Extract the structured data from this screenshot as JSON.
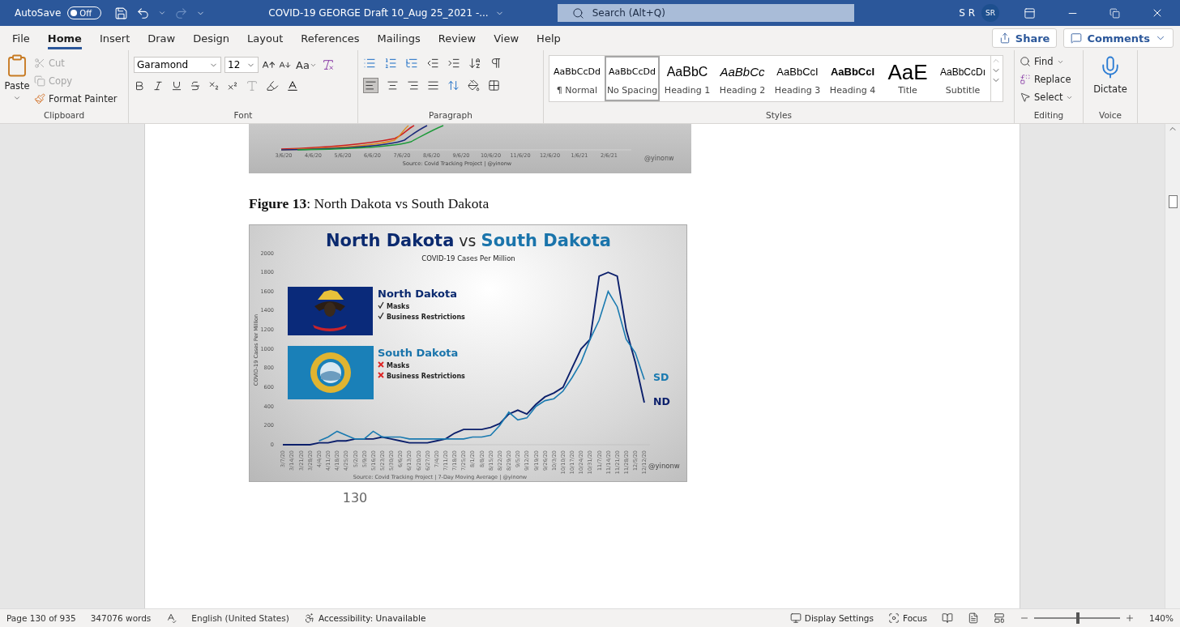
{
  "title_bar": {
    "autosave": {
      "label": "AutoSave",
      "on": false,
      "state_label": "Off"
    },
    "document_title": "COVID-19 GEORGE Draft 10_Aug 25_2021  -...",
    "search": {
      "placeholder": "Search (Alt+Q)"
    },
    "user_name": "S R",
    "avatar": "SR"
  },
  "menu_tabs": [
    {
      "label": "File",
      "selected": false
    },
    {
      "label": "Home",
      "selected": true
    },
    {
      "label": "Insert",
      "selected": false
    },
    {
      "label": "Draw",
      "selected": false
    },
    {
      "label": "Design",
      "selected": false
    },
    {
      "label": "Layout",
      "selected": false
    },
    {
      "label": "References",
      "selected": false
    },
    {
      "label": "Mailings",
      "selected": false
    },
    {
      "label": "Review",
      "selected": false
    },
    {
      "label": "View",
      "selected": false
    },
    {
      "label": "Help",
      "selected": false
    }
  ],
  "share_button": "Share",
  "comments_button": "Comments",
  "ribbon": {
    "clipboard": {
      "label": "Clipboard",
      "paste": "Paste",
      "cut": {
        "label": "Cut",
        "disabled": true
      },
      "copy": {
        "label": "Copy",
        "disabled": true
      },
      "format_painter": {
        "label": "Format Painter",
        "disabled": false
      }
    },
    "font": {
      "label": "Font",
      "font_name": "Garamond",
      "font_size": "12",
      "change_case": "Aa"
    },
    "paragraph": {
      "label": "Paragraph"
    },
    "styles": {
      "label": "Styles",
      "items": [
        {
          "preview": "AaBbCcDd",
          "name": "¶ Normal",
          "selected": false
        },
        {
          "preview": "AaBbCcDd",
          "name": "No Spacing",
          "selected": true
        },
        {
          "preview": "AaBbC",
          "name": "Heading 1",
          "selected": false
        },
        {
          "preview": "AaBbCc",
          "name": "Heading 2",
          "selected": false
        },
        {
          "preview": "AaBbCcI",
          "name": "Heading 3",
          "selected": false
        },
        {
          "preview": "AaBbCcI",
          "name": "Heading 4",
          "selected": false
        },
        {
          "preview": "AaE",
          "name": "Title",
          "selected": false
        },
        {
          "preview": "AaBbCcDı",
          "name": "Subtitle",
          "selected": false
        }
      ]
    },
    "editing": {
      "label": "Editing",
      "find": "Find",
      "replace": "Replace",
      "select": "Select"
    },
    "voice": {
      "label": "Voice",
      "dictate": "Dictate"
    }
  },
  "document": {
    "top_figure": {
      "x_labels": [
        "3/6/20",
        "4/6/20",
        "5/6/20",
        "6/6/20",
        "7/6/20",
        "8/6/20",
        "9/6/20",
        "10/6/20",
        "11/6/20",
        "12/6/20",
        "1/6/21",
        "2/6/21"
      ],
      "source": "Source: Covid Tracking Project | @yinonw",
      "handle": "@yinonw"
    },
    "caption": "**Figure 13**: North Dakota vs South Dakota",
    "chart": {
      "title_left": "North Dakota",
      "title_mid": "vs",
      "title_right": "South Dakota",
      "legend": [
        {
          "state": "North Dakota",
          "color": "#0b2a6f",
          "items": [
            {
              "label": "Masks",
              "checked": true
            },
            {
              "label": "Business Restrictions",
              "checked": true
            }
          ]
        },
        {
          "state": "South Dakota",
          "color": "#1a74ab",
          "items": [
            {
              "label": "Masks",
              "checked": false
            },
            {
              "label": "Business Restrictions",
              "checked": false
            }
          ]
        }
      ],
      "handle": "@yinonw",
      "source": "Source: Covid Tracking Project | 7-Day Moving Average | @yinonw",
      "chart_data": {
        "type": "line",
        "title": "COVID-19 Cases Per Million",
        "ylabel": "COVID-19 Cases Per Million",
        "categories": [
          "3/7/20",
          "3/14/20",
          "3/21/20",
          "3/28/20",
          "4/4/20",
          "4/11/20",
          "4/18/20",
          "4/25/20",
          "5/2/20",
          "5/9/20",
          "5/16/20",
          "5/23/20",
          "5/30/20",
          "6/6/20",
          "6/13/20",
          "6/20/20",
          "6/27/20",
          "7/4/20",
          "7/11/20",
          "7/18/20",
          "7/25/20",
          "8/1/20",
          "8/8/20",
          "8/15/20",
          "8/22/20",
          "8/29/20",
          "9/5/20",
          "9/12/20",
          "9/19/20",
          "9/26/20",
          "10/3/20",
          "10/10/20",
          "10/17/20",
          "10/24/20",
          "10/31/20",
          "11/7/20",
          "11/14/20",
          "11/21/20",
          "11/28/20",
          "12/5/20",
          "12/12/20"
        ],
        "series": [
          {
            "name": "SD",
            "color": "#1a7ab0",
            "values": [
              null,
              null,
              null,
              null,
              40,
              80,
              140,
              100,
              60,
              60,
              140,
              80,
              80,
              80,
              60,
              60,
              60,
              60,
              60,
              60,
              60,
              80,
              80,
              100,
              200,
              340,
              260,
              280,
              400,
              460,
              480,
              560,
              700,
              860,
              1100,
              1300,
              1600,
              1440,
              1100,
              960,
              680
            ]
          },
          {
            "name": "ND",
            "color": "#0b1f6b",
            "values": [
              0,
              0,
              0,
              0,
              20,
              20,
              40,
              40,
              60,
              60,
              60,
              80,
              60,
              40,
              20,
              20,
              20,
              40,
              60,
              120,
              160,
              160,
              160,
              180,
              220,
              320,
              360,
              320,
              420,
              500,
              540,
              600,
              800,
              1000,
              1100,
              1760,
              1800,
              1760,
              1200,
              860,
              440
            ]
          }
        ],
        "ylim": [
          0,
          2000
        ],
        "yticks": [
          0,
          200,
          400,
          600,
          800,
          1000,
          1200,
          1400,
          1600,
          1800,
          2000
        ]
      }
    },
    "page_number": "130"
  },
  "status_bar": {
    "page": "Page 130 of 935",
    "words": "347076 words",
    "language": "English (United States)",
    "accessibility": "Accessibility: Unavailable",
    "display_settings": "Display Settings",
    "focus": "Focus",
    "zoom": {
      "level": 0.49,
      "label": "140%"
    }
  }
}
